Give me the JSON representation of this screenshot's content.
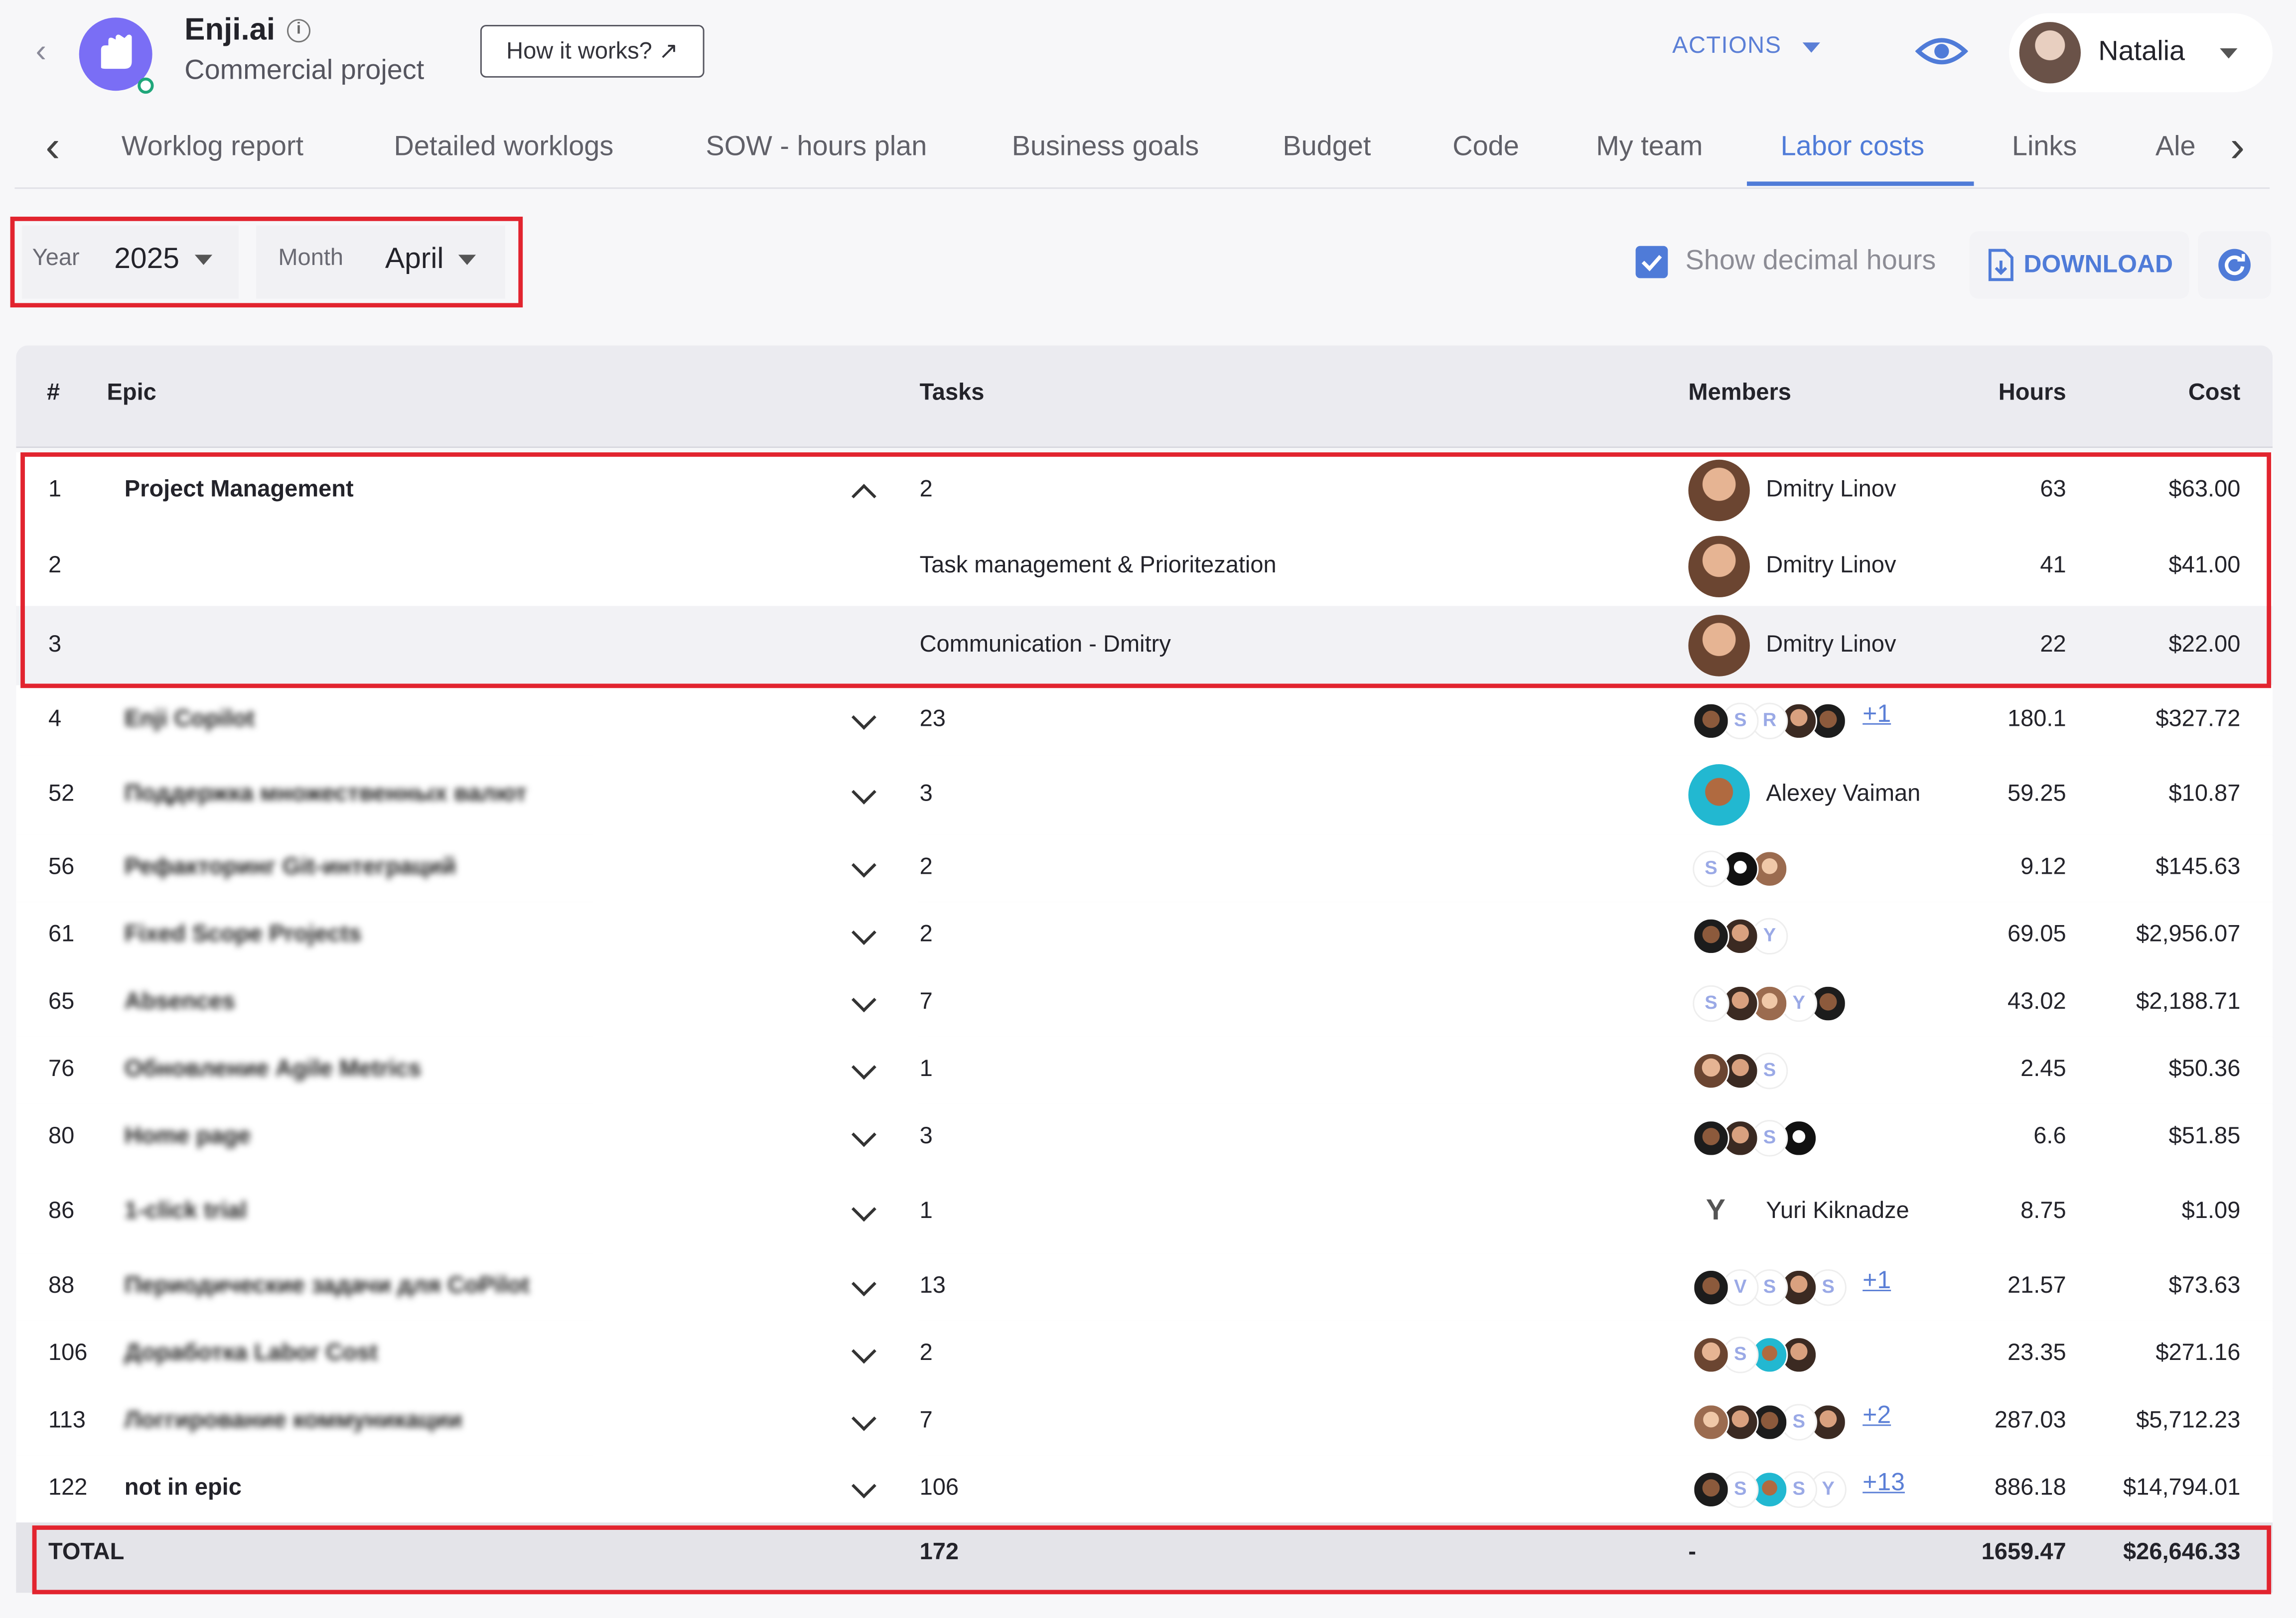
{
  "header": {
    "app_name": "Enji.ai",
    "subtitle": "Commercial project",
    "how_it_works": "How it works? ↗",
    "actions_label": "ACTIONS",
    "user_name": "Natalia"
  },
  "tabs": [
    {
      "label": "Worklog report"
    },
    {
      "label": "Detailed worklogs"
    },
    {
      "label": "SOW - hours plan"
    },
    {
      "label": "Business goals"
    },
    {
      "label": "Budget"
    },
    {
      "label": "Code"
    },
    {
      "label": "My team"
    },
    {
      "label": "Labor costs"
    },
    {
      "label": "Links"
    },
    {
      "label": "Ale"
    }
  ],
  "active_tab": "Labor costs",
  "filters": {
    "year_label": "Year",
    "year_value": "2025",
    "month_label": "Month",
    "month_value": "April"
  },
  "toolbar": {
    "show_decimal_label": "Show decimal hours",
    "show_decimal_checked": true,
    "download_label": "DOWNLOAD"
  },
  "table": {
    "headers": {
      "num": "#",
      "epic": "Epic",
      "tasks": "Tasks",
      "members": "Members",
      "hours": "Hours",
      "cost": "Cost"
    },
    "rows": [
      {
        "num": "1",
        "epic": "Project Management",
        "tasks": "2",
        "members_text": "Dmitry Linov",
        "hours": "63",
        "cost": "$63.00"
      },
      {
        "num": "2",
        "epic": "",
        "tasks": "Task management & Prioritezation",
        "members_text": "Dmitry Linov",
        "hours": "41",
        "cost": "$41.00"
      },
      {
        "num": "3",
        "epic": "",
        "tasks": "Communication - Dmitry",
        "members_text": "Dmitry Linov",
        "hours": "22",
        "cost": "$22.00"
      },
      {
        "num": "4",
        "epic": "Enji Copilot",
        "tasks": "23",
        "more": "+1",
        "hours": "180.1",
        "cost": "$327.72"
      },
      {
        "num": "52",
        "epic": "Поддержка множественных валют",
        "tasks": "3",
        "members_text": "Alexey Vaiman",
        "hours": "59.25",
        "cost": "$10.87"
      },
      {
        "num": "56",
        "epic": "Рефакторинг Git-интеграций",
        "tasks": "2",
        "hours": "9.12",
        "cost": "$145.63"
      },
      {
        "num": "61",
        "epic": "Fixed Scope Projects",
        "tasks": "2",
        "hours": "69.05",
        "cost": "$2,956.07"
      },
      {
        "num": "65",
        "epic": "Absences",
        "tasks": "7",
        "hours": "43.02",
        "cost": "$2,188.71"
      },
      {
        "num": "76",
        "epic": "Обновление Agile Metrics",
        "tasks": "1",
        "hours": "2.45",
        "cost": "$50.36"
      },
      {
        "num": "80",
        "epic": "Home page",
        "tasks": "3",
        "hours": "6.6",
        "cost": "$51.85"
      },
      {
        "num": "86",
        "epic": "1-click trial",
        "tasks": "1",
        "members_text": "Yuri Kiknadze",
        "hours": "8.75",
        "cost": "$1.09"
      },
      {
        "num": "88",
        "epic": "Периодические задачи для CoPilot",
        "tasks": "13",
        "more": "+1",
        "hours": "21.57",
        "cost": "$73.63"
      },
      {
        "num": "106",
        "epic": "Доработка Labor Cost",
        "tasks": "2",
        "hours": "23.35",
        "cost": "$271.16"
      },
      {
        "num": "113",
        "epic": "Логгирование коммуникации",
        "tasks": "7",
        "more": "+2",
        "hours": "287.03",
        "cost": "$5,712.23"
      },
      {
        "num": "122",
        "epic": "not in epic",
        "tasks": "106",
        "more": "+13",
        "hours": "886.18",
        "cost": "$14,794.01"
      }
    ],
    "total": {
      "label": "TOTAL",
      "tasks": "172",
      "members": "-",
      "hours": "1659.47",
      "cost": "$26,646.33"
    }
  },
  "colors": {
    "accent": "#4f7bd8",
    "highlight": "#e2242f",
    "logo": "#7a6ef5"
  }
}
